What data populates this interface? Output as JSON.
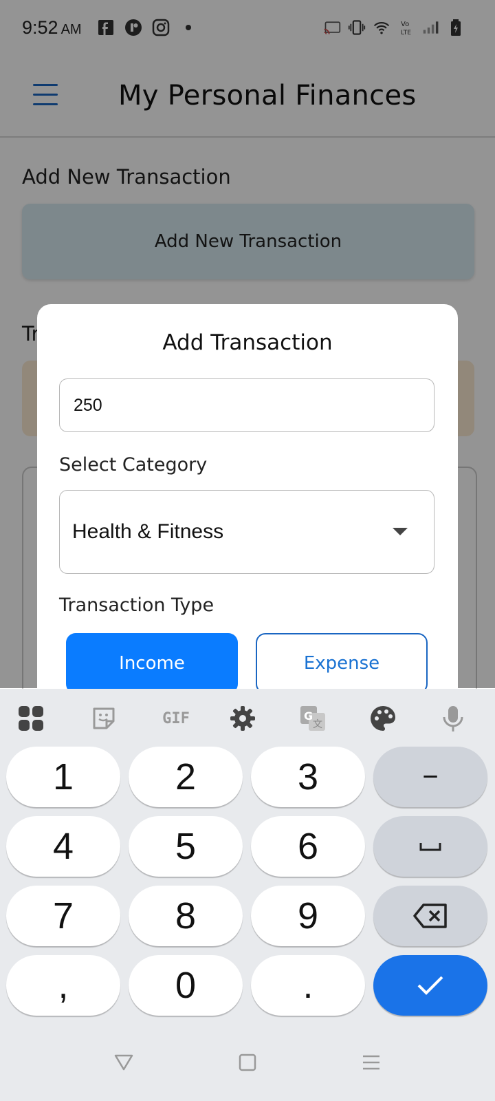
{
  "status_bar": {
    "time": "9:52",
    "ampm": "AM",
    "notification_icons": [
      "facebook-icon",
      "tinder-icon",
      "instagram-icon",
      "more-dot-icon"
    ],
    "system_icons": [
      "cast-icon",
      "vibrate-icon",
      "wifi-icon",
      "volte-icon",
      "signal-icon",
      "battery-icon"
    ]
  },
  "app_bar": {
    "title": "My Personal Finances",
    "menu_icon": "hamburger-menu-icon"
  },
  "main": {
    "section_title": "Add New Transaction",
    "add_button_label": "Add New Transaction",
    "transactions_heading_partial": "Tr"
  },
  "dialog": {
    "title": "Add Transaction",
    "amount_value": "250",
    "category_label": "Select Category",
    "category_selected": "Health & Fitness",
    "type_label": "Transaction Type",
    "type_income": "Income",
    "type_expense": "Expense",
    "selected_type": "Income"
  },
  "keyboard": {
    "toolbar": [
      "apps-grid-icon",
      "sticker-icon",
      "gif-icon",
      "settings-gear-icon",
      "translate-icon",
      "theme-palette-icon",
      "microphone-icon"
    ],
    "gif_label": "GIF",
    "keys": {
      "k1": "1",
      "k2": "2",
      "k3": "3",
      "minus": "−",
      "k4": "4",
      "k5": "5",
      "k6": "6",
      "space": "␣",
      "k7": "7",
      "k8": "8",
      "k9": "9",
      "comma": ",",
      "k0": "0",
      "period": "."
    }
  },
  "nav_bar": [
    "back-triangle-icon",
    "home-square-icon",
    "recents-lines-icon"
  ],
  "colors": {
    "accent_blue": "#1a73e8",
    "income_blue": "#0a7cff",
    "scrim": "rgba(0,0,0,0.42)"
  }
}
